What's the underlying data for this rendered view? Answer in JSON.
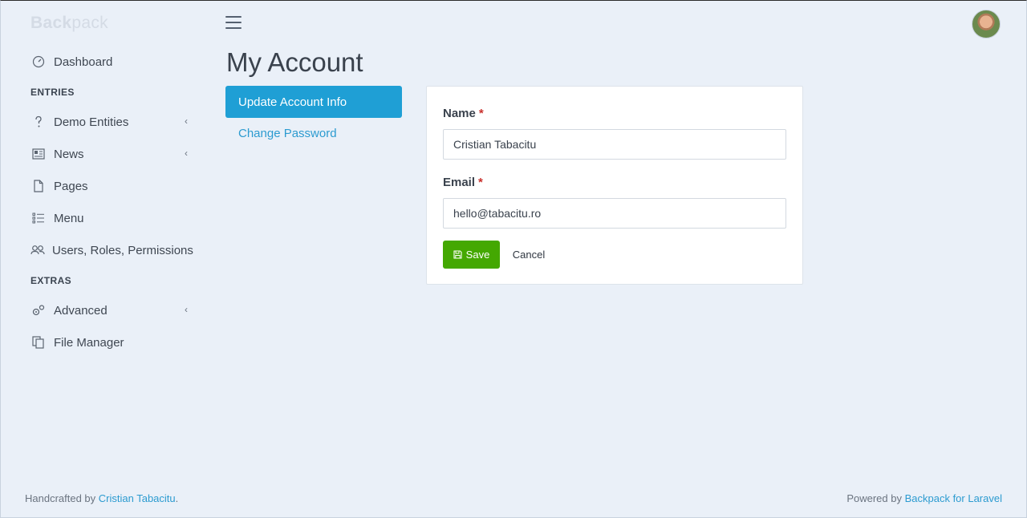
{
  "brand": {
    "bold": "Back",
    "light": "pack"
  },
  "sidebar": {
    "dashboard": "Dashboard",
    "section_entries": "ENTRIES",
    "demo_entities": "Demo Entities",
    "news": "News",
    "pages": "Pages",
    "menu": "Menu",
    "users": "Users, Roles, Permissions",
    "section_extras": "EXTRAS",
    "advanced": "Advanced",
    "file_manager": "File Manager",
    "caret": "‹"
  },
  "header": {
    "title": "My Account"
  },
  "tabs": {
    "update": "Update Account Info",
    "password": "Change Password"
  },
  "form": {
    "name_label": "Name",
    "name_value": "Cristian Tabacitu",
    "email_label": "Email",
    "email_value": "hello@tabacitu.ro",
    "required_mark": "*",
    "save_label": "Save",
    "cancel_label": "Cancel"
  },
  "footer": {
    "left_prefix": "Handcrafted by ",
    "left_link": "Cristian Tabacitu",
    "left_suffix": ".",
    "right_prefix": "Powered by ",
    "right_link": "Backpack for Laravel"
  },
  "colors": {
    "accent": "#1f9fd5",
    "save": "#44a802",
    "background": "#eaf0f8",
    "required": "#c9302c"
  }
}
